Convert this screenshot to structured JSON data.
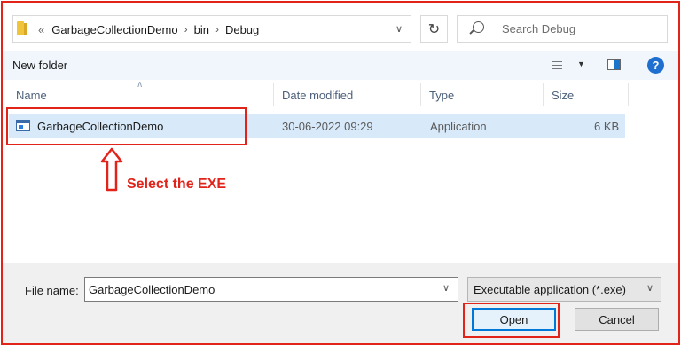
{
  "address_bar": {
    "lead": "«",
    "crumbs": [
      "GarbageCollectionDemo",
      "bin",
      "Debug"
    ],
    "separator": "›"
  },
  "search": {
    "placeholder": "Search Debug"
  },
  "toolbar": {
    "new_folder": "New folder",
    "help": "?"
  },
  "columns": {
    "name": "Name",
    "date": "Date modified",
    "type": "Type",
    "size": "Size"
  },
  "files": [
    {
      "name": "GarbageCollectionDemo",
      "date": "30-06-2022 09:29",
      "type": "Application",
      "size": "6 KB"
    }
  ],
  "annotation": {
    "text": "Select the EXE",
    "color": "#e2231a"
  },
  "bottom": {
    "file_name_label": "File name:",
    "file_name_value": "GarbageCollectionDemo",
    "file_type": "Executable application (*.exe)",
    "open_label": "Open",
    "cancel_label": "Cancel"
  },
  "icons": [
    "folder-icon",
    "chevron-down-icon",
    "refresh-icon",
    "search-icon",
    "view-options-icon",
    "preview-pane-icon",
    "help-icon",
    "application-icon",
    "sort-up-icon",
    "arrow-up-icon"
  ]
}
